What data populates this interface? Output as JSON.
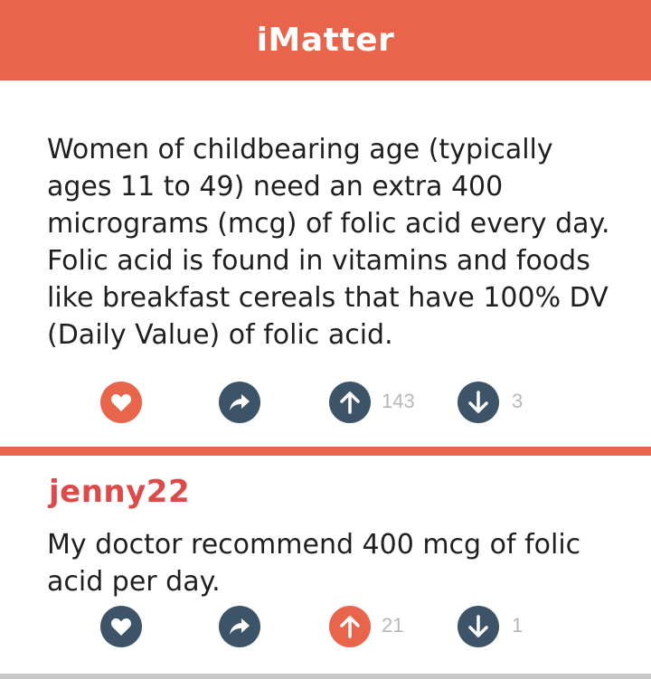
{
  "header": {
    "title": "iMatter"
  },
  "colors": {
    "brand": "#e8644a",
    "dark_button": "#3d5468",
    "author": "#dc4a4a",
    "count": "#b8b8b8"
  },
  "post": {
    "text": "Women of childbearing age (typically ages 11 to 49) need an extra 400 micrograms (mcg) of folic acid every day. Folic acid is found in vitamins and foods like breakfast cereals that have 100% DV (Daily Value) of folic acid.",
    "actions": {
      "like_icon": "heart-icon",
      "like_active": true,
      "share_icon": "share-arrow-icon",
      "upvote_icon": "arrow-up-icon",
      "upvote_count": "143",
      "upvote_active": false,
      "downvote_icon": "arrow-down-icon",
      "downvote_count": "3"
    }
  },
  "comment": {
    "author": "jenny22",
    "text": "My doctor recommend 400 mcg of folic acid per day.",
    "actions": {
      "like_icon": "heart-icon",
      "like_active": false,
      "share_icon": "share-arrow-icon",
      "upvote_icon": "arrow-up-icon",
      "upvote_count": "21",
      "upvote_active": true,
      "downvote_icon": "arrow-down-icon",
      "downvote_count": "1"
    }
  }
}
